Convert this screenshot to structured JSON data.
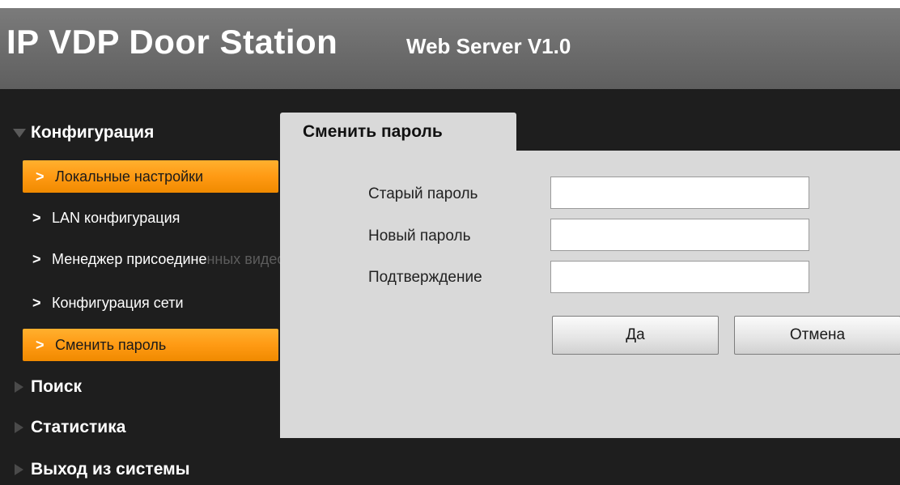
{
  "header": {
    "title": "IP VDP Door Station",
    "subtitle": "Web Server V1.0"
  },
  "sidebar": {
    "config_section": "Конфигурация",
    "items": [
      {
        "label": "Локальные настройки",
        "active": true
      },
      {
        "label": "LAN конфигурация",
        "active": false
      },
      {
        "label": "Менеджер присоедине",
        "overflow": "нных видеодомофонов",
        "active": false
      },
      {
        "label": "Конфигурация сети",
        "active": false
      },
      {
        "label": "Сменить пароль",
        "active": true
      }
    ],
    "chevron": ">",
    "search_section": "Поиск",
    "stats_section": "Статистика",
    "logout_section": "Выход из системы"
  },
  "panel": {
    "tab_title": "Сменить пароль",
    "fields": {
      "old_password_label": "Старый пароль",
      "old_password_value": "",
      "new_password_label": "Новый пароль",
      "new_password_value": "",
      "confirm_label": "Подтверждение",
      "confirm_value": ""
    },
    "ok_button": "Да",
    "cancel_button": "Отмена"
  },
  "colors": {
    "accent": "#ff9a14",
    "header_bg": "#6b6b6b",
    "main_bg": "#1e1e1e",
    "panel_bg": "#d9d9d9"
  },
  "icons": {
    "expanded": "triangle-down-icon",
    "collapsed": "triangle-right-icon"
  }
}
